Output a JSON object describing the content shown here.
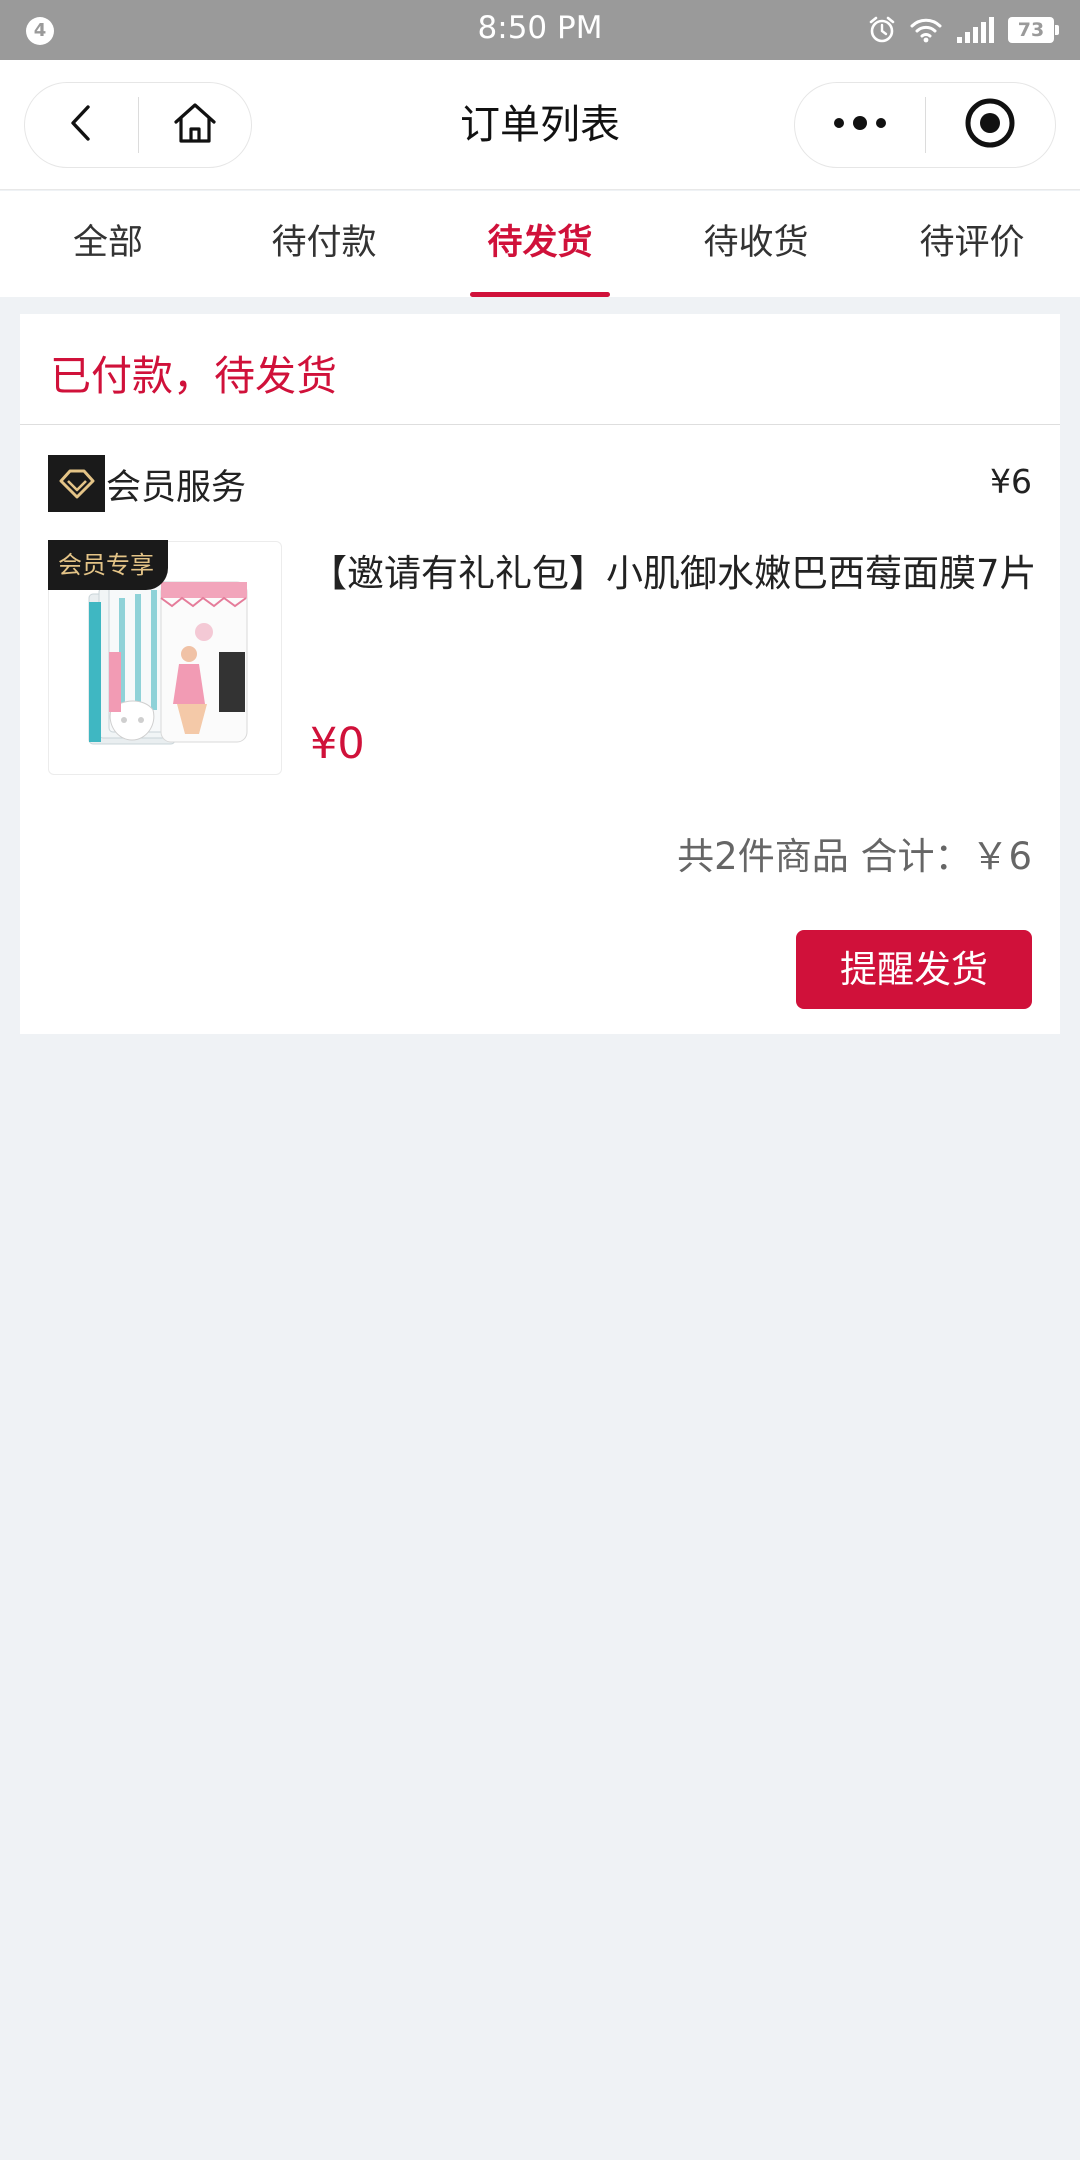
{
  "status_bar": {
    "notification_count": "4",
    "time": "8:50 PM",
    "battery": "73",
    "icons": [
      "alarm-icon",
      "wifi-icon",
      "signal-icon",
      "battery-icon"
    ]
  },
  "navbar": {
    "title": "订单列表",
    "icons": [
      "back-icon",
      "home-icon",
      "more-icon",
      "record-icon"
    ]
  },
  "tabs": [
    {
      "label": "全部",
      "active": false
    },
    {
      "label": "待付款",
      "active": false
    },
    {
      "label": "待发货",
      "active": true
    },
    {
      "label": "待收货",
      "active": false
    },
    {
      "label": "待评价",
      "active": false
    }
  ],
  "order": {
    "status": "已付款，待发货",
    "shop": {
      "name": "会员服务",
      "price": "¥6",
      "icon": "diamond-icon"
    },
    "item": {
      "badge": "会员专享",
      "name": "【邀请有礼礼包】小肌御水嫩巴西莓面膜7片",
      "price": "¥0"
    },
    "summary": "共2件商品 合计：￥6",
    "remind_button": "提醒发货"
  },
  "colors": {
    "accent": "#d0113a",
    "background": "#eff2f5",
    "status_bar": "#9a9a9a",
    "badge_text": "#e4c487"
  }
}
